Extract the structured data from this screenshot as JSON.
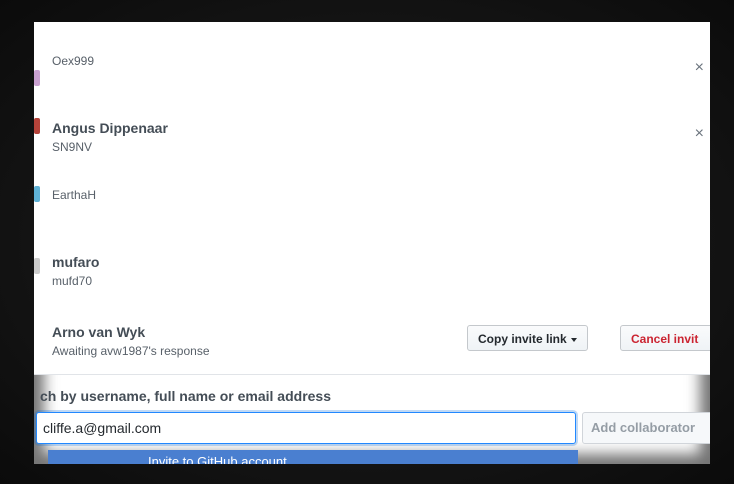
{
  "collaborators": [
    {
      "name": "",
      "username": "Oex999",
      "avatar_color": "#c9a0d0"
    },
    {
      "name": "Angus Dippenaar",
      "username": "SN9NV",
      "avatar_color": "#b5433a"
    },
    {
      "name": "",
      "username": "EarthaH",
      "avatar_color": "#5fb2d6"
    },
    {
      "name": "mufaro",
      "username": "mufd70",
      "avatar_color": "#cccccc"
    }
  ],
  "pending_invite": {
    "name": "Arno van Wyk",
    "status": "Awaiting avw1987's response",
    "copy_label": "Copy invite link",
    "cancel_label": "Cancel invit"
  },
  "search": {
    "label": "ch by username, full name or email address",
    "value": "cliffe.a@gmail.com",
    "add_label": "Add collaborator",
    "suggestion": "Invite to GitHub account"
  },
  "icons": {
    "close": "×"
  }
}
